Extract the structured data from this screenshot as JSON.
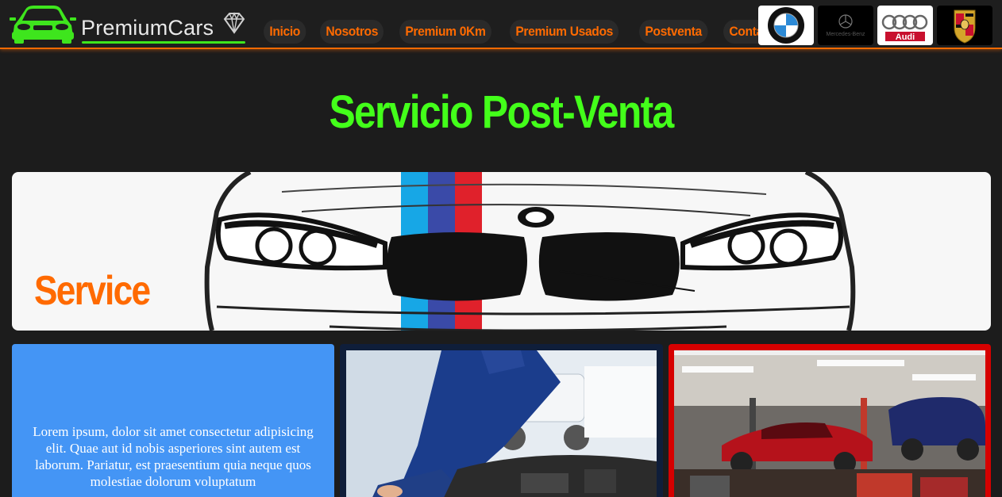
{
  "brand": {
    "name": "PremiumCars",
    "color": "#3ee51d"
  },
  "nav": {
    "items": [
      {
        "label": "Inicio"
      },
      {
        "label": "Nosotros"
      },
      {
        "label": "Premium 0Km"
      },
      {
        "label": "Premium Usados"
      },
      {
        "label": "Postventa"
      },
      {
        "label": "Contacto"
      }
    ],
    "color": "#ff6a00"
  },
  "brand_logos": [
    {
      "name": "bmw-logo",
      "text": "B M W"
    },
    {
      "name": "mercedes-benz-logo",
      "text": "Mercedes-Benz"
    },
    {
      "name": "audi-logo",
      "text": "Audi"
    },
    {
      "name": "porsche-logo",
      "text": ""
    }
  ],
  "main": {
    "title": "Servicio Post-Venta",
    "banner_label": "Service",
    "card_text": "Lorem ipsum, dolor sit amet consectetur adipisicing elit. Quae aut id nobis asperiores sint autem est laborum. Pariatur, est praesentium quia neque quos molestiae dolorum voluptatum"
  },
  "colors": {
    "background": "#1c1c1c",
    "title": "#43ff1a",
    "accent": "#ff6a00",
    "card_blue": "#4495f5",
    "card_red": "#d60000"
  }
}
